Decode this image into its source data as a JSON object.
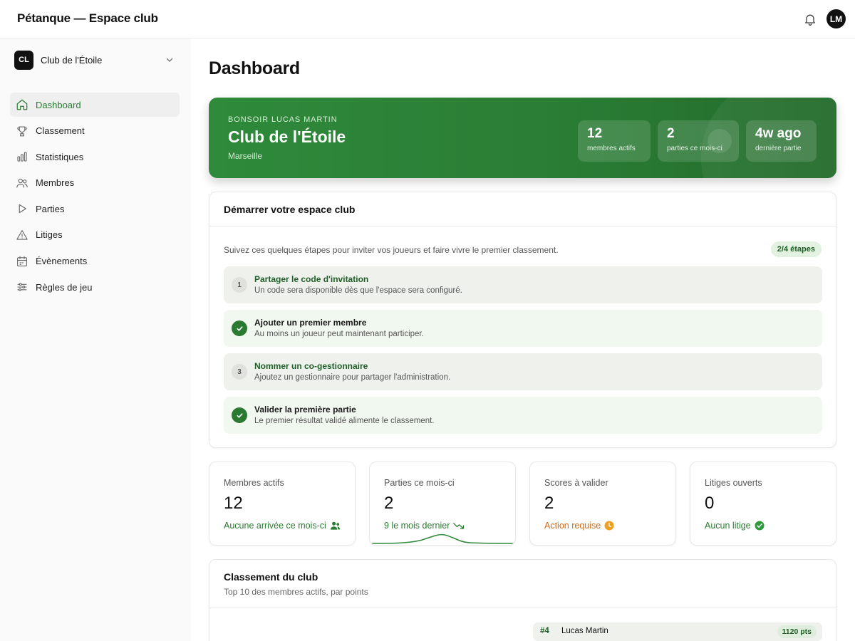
{
  "app": {
    "title": "Pétanque — Espace club",
    "avatar_initials": "LM"
  },
  "club_switcher": {
    "initials": "CL",
    "name": "Club de l'Étoile"
  },
  "sidebar": {
    "items": [
      {
        "label": "Dashboard",
        "icon": "home-icon",
        "active": true
      },
      {
        "label": "Classement",
        "icon": "trophy-icon"
      },
      {
        "label": "Statistiques",
        "icon": "bar-chart-icon"
      },
      {
        "label": "Membres",
        "icon": "users-icon"
      },
      {
        "label": "Parties",
        "icon": "play-icon"
      },
      {
        "label": "Litiges",
        "icon": "warning-icon"
      },
      {
        "label": "Évènements",
        "icon": "calendar-icon"
      },
      {
        "label": "Règles de jeu",
        "icon": "sliders-icon"
      }
    ]
  },
  "page": {
    "title": "Dashboard"
  },
  "hero": {
    "greeting": "BONSOIR LUCAS MARTIN",
    "club": "Club de l'Étoile",
    "city": "Marseille",
    "stats": [
      {
        "value": "12",
        "label": "membres actifs"
      },
      {
        "value": "2",
        "label": "parties ce mois-ci"
      },
      {
        "value": "4w ago",
        "label": "dernière partie"
      }
    ]
  },
  "setup": {
    "title": "Démarrer votre espace club",
    "intro": "Suivez ces quelques étapes pour inviter vos joueurs et faire vivre le premier classement.",
    "progress": "2/4 étapes",
    "steps": [
      {
        "num": "1",
        "title": "Partager le code d'invitation",
        "desc": "Un code sera disponible dès que l'espace sera configuré.",
        "done": false
      },
      {
        "num": "2",
        "title": "Ajouter un premier membre",
        "desc": "Au moins un joueur peut maintenant participer.",
        "done": true
      },
      {
        "num": "3",
        "title": "Nommer un co-gestionnaire",
        "desc": "Ajoutez un gestionnaire pour partager l'administration.",
        "done": false
      },
      {
        "num": "4",
        "title": "Valider la première partie",
        "desc": "Le premier résultat validé alimente le classement.",
        "done": true
      }
    ]
  },
  "kpis": [
    {
      "label": "Membres actifs",
      "value": "12",
      "note": "Aucune arrivée ce mois-ci",
      "tone": "green",
      "icon": "users-icon"
    },
    {
      "label": "Parties ce mois-ci",
      "value": "2",
      "note": "9 le mois dernier",
      "tone": "green",
      "icon": "trend-down-icon"
    },
    {
      "label": "Scores à valider",
      "value": "2",
      "note": "Action requise",
      "tone": "orange",
      "icon": "clock-icon"
    },
    {
      "label": "Litiges ouverts",
      "value": "0",
      "note": "Aucun litige",
      "tone": "green",
      "icon": "check-circle-icon"
    }
  ],
  "ranking": {
    "title": "Classement du club",
    "subtitle": "Top 10 des membres actifs, par points",
    "rows": [
      {
        "rank": "#4",
        "name": "Lucas Martin",
        "points": "1120 pts"
      }
    ]
  },
  "colors": {
    "brand_green": "#2a7a32",
    "warning_orange": "#d06a12"
  }
}
